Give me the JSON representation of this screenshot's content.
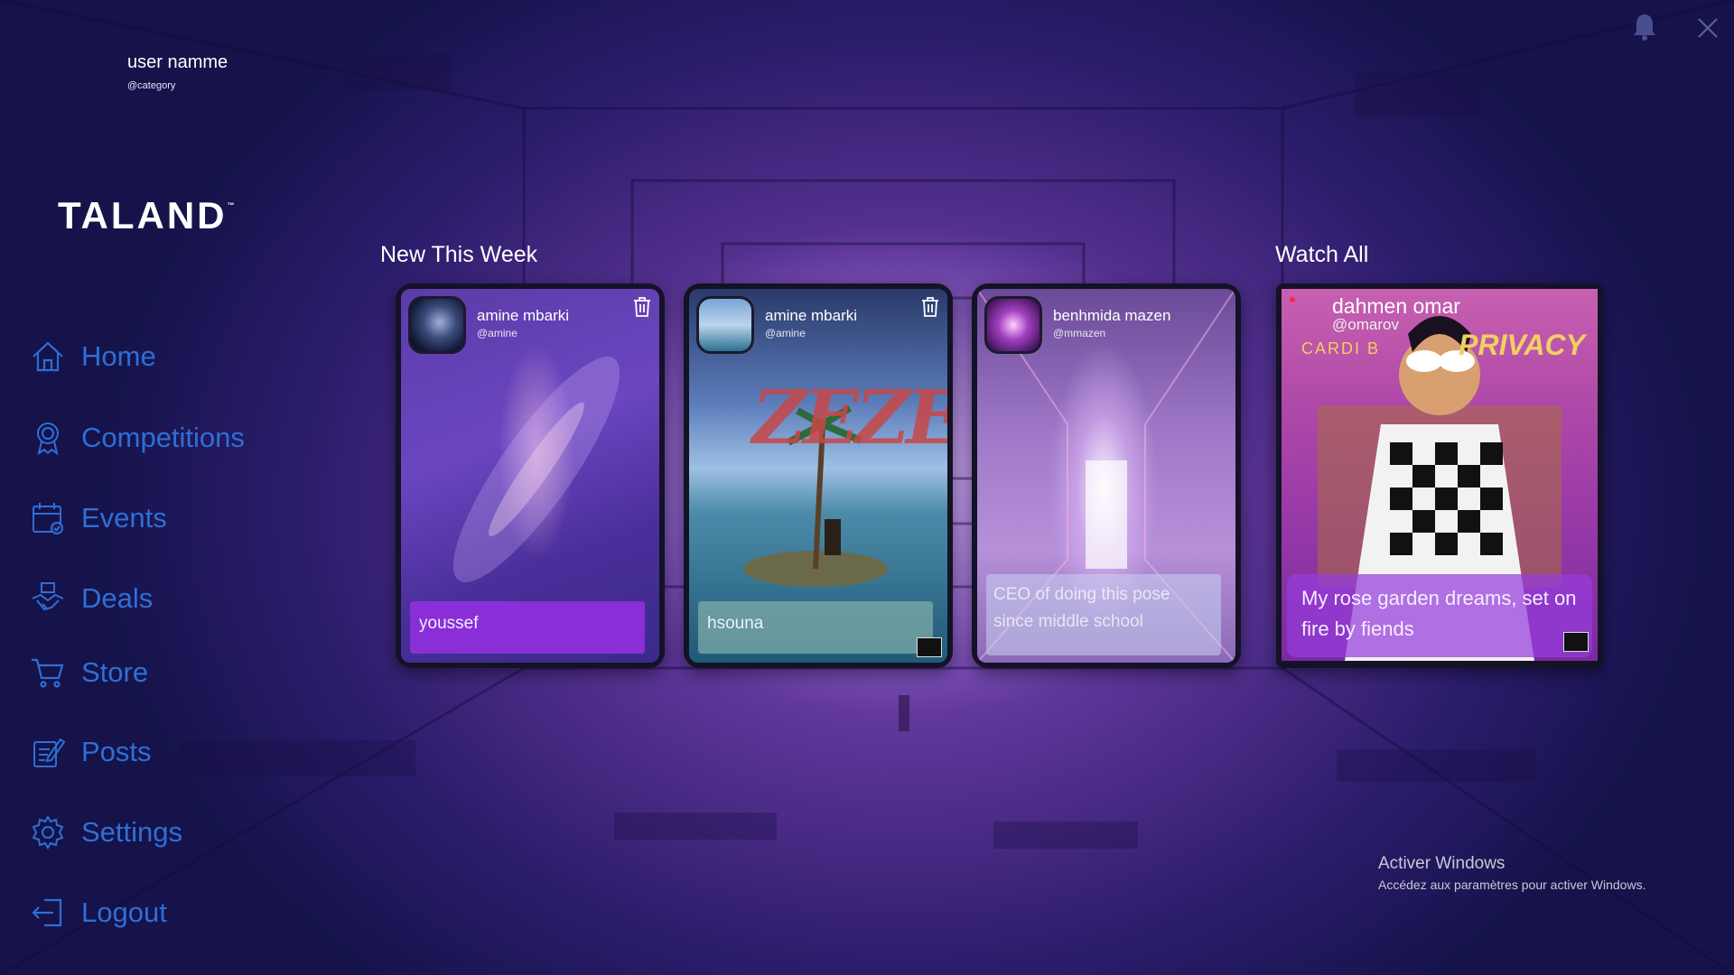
{
  "user": {
    "name": "user namme",
    "category": "@category"
  },
  "brand": {
    "logo": "TALAND",
    "trademark": "™"
  },
  "nav": {
    "items": [
      {
        "label": "Home",
        "icon": "home-icon"
      },
      {
        "label": "Competitions",
        "icon": "award-icon"
      },
      {
        "label": "Events",
        "icon": "calendar-icon"
      },
      {
        "label": "Deals",
        "icon": "handshake-icon"
      },
      {
        "label": "Store",
        "icon": "cart-icon"
      },
      {
        "label": "Posts",
        "icon": "edit-icon"
      },
      {
        "label": "Settings",
        "icon": "gear-icon"
      },
      {
        "label": "Logout",
        "icon": "logout-icon"
      }
    ]
  },
  "sections": {
    "new_this_week": "New This Week",
    "watch_all": "Watch All"
  },
  "cards": [
    {
      "name": "amine mbarki",
      "handle": "@amine",
      "caption": "youssef",
      "has_delete": true
    },
    {
      "name": "amine mbarki",
      "handle": "@amine",
      "caption": "hsouna",
      "has_delete": true,
      "art_text": "ZEZE"
    },
    {
      "name": "benhmida mazen",
      "handle": "@mmazen",
      "caption": "CEO of doing this pose since middle school",
      "has_delete": false
    }
  ],
  "watch_card": {
    "name": "dahmen omar",
    "handle": "@omarov",
    "caption": "My rose garden dreams, set on fire by fiends",
    "art_text_left": "CARDI B",
    "art_text_right": "PRIVACY"
  },
  "top_icons": {
    "bell": "bell-icon",
    "close": "close-icon"
  },
  "watermark": {
    "title": "Activer Windows",
    "subtitle": "Accédez aux paramètres pour activer Windows."
  },
  "colors": {
    "nav_text": "#2e6fd6",
    "caption_purple": "#8a2fd8",
    "card_bg": "#141226"
  }
}
